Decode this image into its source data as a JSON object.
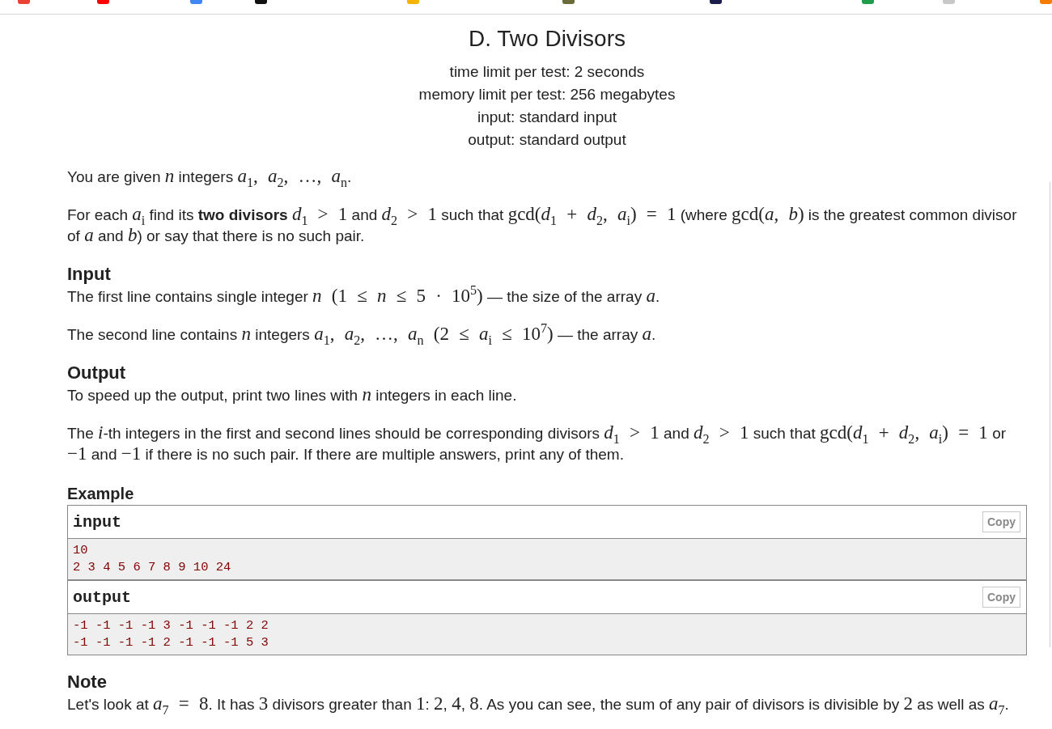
{
  "problem": {
    "title": "D. Two Divisors",
    "limits": [
      "time limit per test: 2 seconds",
      "memory limit per test: 256 megabytes",
      "input: standard input",
      "output: standard output"
    ]
  },
  "statement": [
    [
      {
        "kind": "text",
        "text": "You are given "
      },
      {
        "kind": "math",
        "text": "*n*"
      },
      {
        "kind": "text",
        "text": " integers "
      },
      {
        "kind": "math",
        "text": "*a*$_{1}$, *a*$_{2}$, …, *a*$_{n}$"
      },
      {
        "kind": "text",
        "text": "."
      }
    ],
    [
      {
        "kind": "text",
        "text": "For each "
      },
      {
        "kind": "math",
        "text": "*a*$_{i}$"
      },
      {
        "kind": "text",
        "text": " find its **two divisors** "
      },
      {
        "kind": "math",
        "text": "*d*$_{1}$ > 1"
      },
      {
        "kind": "text",
        "text": " and "
      },
      {
        "kind": "math",
        "text": "*d*$_{2}$ > 1"
      },
      {
        "kind": "text",
        "text": " such that "
      },
      {
        "kind": "math",
        "text": "gcd(*d*$_{1}$ + *d*$_{2}$, *a*$_{i}$) = 1"
      },
      {
        "kind": "text",
        "text": " (where "
      },
      {
        "kind": "math",
        "text": "gcd(*a*, *b*)"
      },
      {
        "kind": "text",
        "text": " is the greatest common divisor of "
      },
      {
        "kind": "math",
        "text": "*a*"
      },
      {
        "kind": "text",
        "text": " and "
      },
      {
        "kind": "math",
        "text": "*b*"
      },
      {
        "kind": "text",
        "text": ") or say that there is no such pair."
      }
    ]
  ],
  "sections": [
    {
      "title": "Input",
      "paragraphs": [
        [
          {
            "kind": "text",
            "text": "The first line contains single integer "
          },
          {
            "kind": "math",
            "text": "*n* (1 ≤ *n* ≤ 5 · 10$^{5}$)"
          },
          {
            "kind": "text",
            "text": " — the size of the array "
          },
          {
            "kind": "math",
            "text": "*a*"
          },
          {
            "kind": "text",
            "text": "."
          }
        ],
        [
          {
            "kind": "text",
            "text": "The second line contains "
          },
          {
            "kind": "math",
            "text": "*n*"
          },
          {
            "kind": "text",
            "text": " integers "
          },
          {
            "kind": "math",
            "text": "*a*$_{1}$, *a*$_{2}$, …, *a*$_{n}$ (2 ≤ *a*$_{i}$ ≤ 10$^{7}$)"
          },
          {
            "kind": "text",
            "text": " — the array "
          },
          {
            "kind": "math",
            "text": "*a*"
          },
          {
            "kind": "text",
            "text": "."
          }
        ]
      ]
    },
    {
      "title": "Output",
      "paragraphs": [
        [
          {
            "kind": "text",
            "text": "To speed up the output, print two lines with "
          },
          {
            "kind": "math",
            "text": "*n*"
          },
          {
            "kind": "text",
            "text": " integers in each line."
          }
        ],
        [
          {
            "kind": "text",
            "text": "The "
          },
          {
            "kind": "math",
            "text": "*i*"
          },
          {
            "kind": "text",
            "text": "-th integers in the first and second lines should be corresponding divisors "
          },
          {
            "kind": "math",
            "text": "*d*$_{1}$ > 1"
          },
          {
            "kind": "text",
            "text": " and "
          },
          {
            "kind": "math",
            "text": "*d*$_{2}$ > 1"
          },
          {
            "kind": "text",
            "text": " such that "
          },
          {
            "kind": "math",
            "text": "gcd(*d*$_{1}$ + *d*$_{2}$, *a*$_{i}$) = 1"
          },
          {
            "kind": "text",
            "text": " or "
          },
          {
            "kind": "math",
            "text": "−1"
          },
          {
            "kind": "text",
            "text": " and "
          },
          {
            "kind": "math",
            "text": "−1"
          },
          {
            "kind": "text",
            "text": " if there is no such pair. If there are multiple answers, print any of them."
          }
        ]
      ]
    }
  ],
  "example": {
    "title": "Example",
    "blocks": [
      {
        "title": "input",
        "copy": "Copy",
        "lines": [
          "10",
          "2 3 4 5 6 7 8 9 10 24"
        ]
      },
      {
        "title": "output",
        "copy": "Copy",
        "lines": [
          "-1 -1 -1 -1 3 -1 -1 -1 2 2",
          "-1 -1 -1 -1 2 -1 -1 -1 5 3"
        ]
      }
    ]
  },
  "note": {
    "title": "Note",
    "paragraphs": [
      [
        {
          "kind": "text",
          "text": "Let's look at "
        },
        {
          "kind": "math",
          "text": "*a*$_{7}$ = 8"
        },
        {
          "kind": "text",
          "text": ". It has "
        },
        {
          "kind": "math",
          "text": "3"
        },
        {
          "kind": "text",
          "text": " divisors greater than "
        },
        {
          "kind": "math",
          "text": "1"
        },
        {
          "kind": "text",
          "text": ": "
        },
        {
          "kind": "math",
          "text": "2"
        },
        {
          "kind": "text",
          "text": ", "
        },
        {
          "kind": "math",
          "text": "4"
        },
        {
          "kind": "text",
          "text": ", "
        },
        {
          "kind": "math",
          "text": "8"
        },
        {
          "kind": "text",
          "text": ". As you can see, the sum of any pair of divisors is divisible by "
        },
        {
          "kind": "math",
          "text": "2"
        },
        {
          "kind": "text",
          "text": " as well as "
        },
        {
          "kind": "math",
          "text": "*a*$_{7}$"
        },
        {
          "kind": "text",
          "text": "."
        }
      ]
    ]
  }
}
